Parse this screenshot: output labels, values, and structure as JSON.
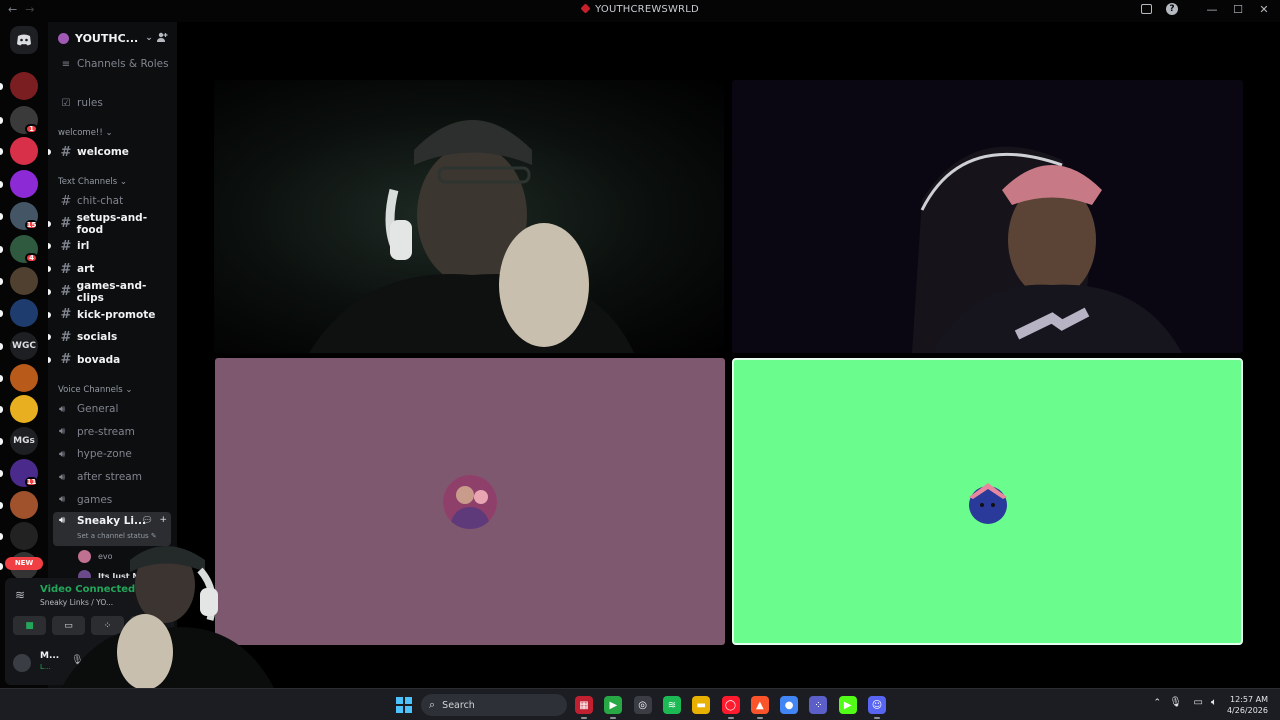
{
  "titlebar": {
    "title": "YOUTHCREWSWRLD",
    "back_icon": "arrow-left-icon",
    "forward_icon": "arrow-right-icon",
    "inbox_icon": "inbox-icon",
    "help_icon": "help-icon",
    "help_glyph": "?"
  },
  "rail": {
    "home_icon": "discord-logo-icon",
    "servers": [
      {
        "label": "",
        "color": "#7a1e22",
        "badge": ""
      },
      {
        "label": "",
        "color": "#3a3a3a",
        "badge": "1"
      },
      {
        "label": "",
        "color": "#d9304a",
        "badge": ""
      },
      {
        "label": "",
        "color": "#8c2bd6",
        "badge": ""
      },
      {
        "label": "",
        "color": "#445566",
        "badge": "15"
      },
      {
        "label": "",
        "color": "#2f5a3f",
        "badge": "4"
      },
      {
        "label": "",
        "color": "#504030",
        "badge": ""
      },
      {
        "label": "",
        "color": "#1e3c6e",
        "badge": ""
      },
      {
        "label": "WGC",
        "color": "#1e1f22",
        "badge": ""
      },
      {
        "label": "",
        "color": "#b85a1a",
        "badge": ""
      },
      {
        "label": "",
        "color": "#e8b020",
        "badge": ""
      },
      {
        "label": "MGs",
        "color": "#1e1f22",
        "badge": ""
      },
      {
        "label": "",
        "color": "#4a2a8a",
        "badge": "11"
      },
      {
        "label": "",
        "color": "#a0522d",
        "badge": ""
      },
      {
        "label": "",
        "color": "#222",
        "badge": ""
      },
      {
        "label": "",
        "color": "#333",
        "badge": ""
      }
    ],
    "new_pill": "NEW"
  },
  "sidebar": {
    "server_name": "YOUTHC...",
    "channels_roles": "Channels & Roles",
    "rules": "rules",
    "cat_welcome": "welcome!! ⌄",
    "welcome": "welcome",
    "cat_text": "Text Channels ⌄",
    "text_channels": [
      {
        "name": "chit-chat",
        "bold": false
      },
      {
        "name": "setups-and-food",
        "bold": true
      },
      {
        "name": "irl",
        "bold": true
      },
      {
        "name": "art",
        "bold": true
      },
      {
        "name": "games-and-clips",
        "bold": true
      },
      {
        "name": "kick-promote",
        "bold": true
      },
      {
        "name": "socials",
        "bold": true
      },
      {
        "name": "bovada",
        "bold": true
      }
    ],
    "cat_voice": "Voice Channels ⌄",
    "voice_channels": [
      "General",
      "pre-stream",
      "hype-zone",
      "after stream",
      "games"
    ],
    "active_voice": "Sneaky Li...",
    "set_status": "Set a channel status",
    "members": [
      {
        "name": "evo",
        "color": "#c07090"
      },
      {
        "name": "Its Just Mil...",
        "color": "#6a4a8a"
      }
    ]
  },
  "voice_panel": {
    "status": "Video Connected",
    "subtitle": "Sneaky Links / YO...",
    "user": "M...",
    "user_sub": "L..."
  },
  "stage": {
    "tiles": [
      {
        "kind": "camera",
        "label": "camera-feed-1"
      },
      {
        "kind": "camera",
        "label": "camera-feed-2"
      },
      {
        "kind": "avatar",
        "bg": "#7d586f"
      },
      {
        "kind": "avatar",
        "bg": "#6afd8d"
      }
    ]
  },
  "taskbar": {
    "search_placeholder": "Search",
    "apps": [
      {
        "name": "app-icon",
        "color": "#c02030"
      },
      {
        "name": "play-icon",
        "color": "#27a844"
      },
      {
        "name": "obs-icon",
        "color": "#3a3d44"
      },
      {
        "name": "spotify-icon",
        "color": "#1db954"
      },
      {
        "name": "file-explorer-icon",
        "color": "#e8b100"
      },
      {
        "name": "opera-icon",
        "color": "#ff1b2d"
      },
      {
        "name": "brave-icon",
        "color": "#fb542b"
      },
      {
        "name": "chrome-icon",
        "color": "#4285f4"
      },
      {
        "name": "grid-app-icon",
        "color": "#5b5fc7"
      },
      {
        "name": "kick-icon",
        "color": "#53fc18"
      },
      {
        "name": "discord-icon",
        "color": "#5865f2"
      }
    ],
    "time": "12:57 AM",
    "date": "4/26/2026"
  }
}
